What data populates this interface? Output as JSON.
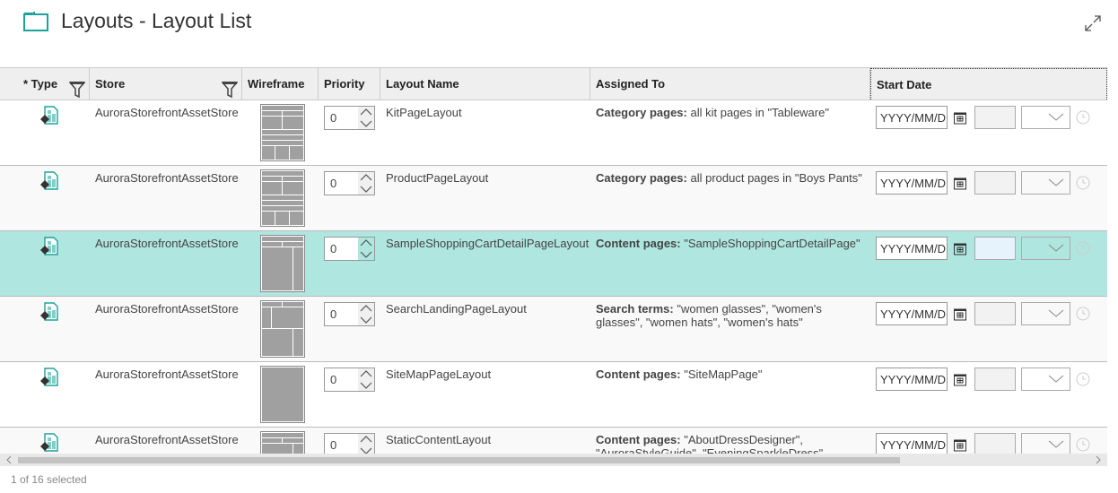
{
  "header": {
    "title": "Layouts - Layout List",
    "icon": "folder-icon",
    "accent": "#1aa39a"
  },
  "columns": [
    "* Type",
    "Store",
    "Wireframe",
    "Priority",
    "Layout Name",
    "Assigned To",
    "Start Date"
  ],
  "rows": [
    {
      "store": "AuroraStorefrontAssetStore",
      "wireframe": "a",
      "priority": "0",
      "name": "KitPageLayout",
      "assign_label": "Category pages:",
      "assign_value": " all kit pages in \"Tableware\"",
      "date_placeholder": "YYYY/MM/DD",
      "selected": false
    },
    {
      "store": "AuroraStorefrontAssetStore",
      "wireframe": "a",
      "priority": "0",
      "name": "ProductPageLayout",
      "assign_label": "Category pages:",
      "assign_value": " all product pages in \"Boys Pants\"",
      "date_placeholder": "YYYY/MM/DD",
      "selected": false
    },
    {
      "store": "AuroraStorefrontAssetStore",
      "wireframe": "b",
      "priority": "0",
      "name": "SampleShoppingCartDetailPageLayout",
      "assign_label": "Content pages:",
      "assign_value": " \"SampleShoppingCartDetailPage\"",
      "date_placeholder": "YYYY/MM/DD",
      "selected": true
    },
    {
      "store": "AuroraStorefrontAssetStore",
      "wireframe": "c",
      "priority": "0",
      "name": "SearchLandingPageLayout",
      "assign_label": "Search terms:",
      "assign_value": " \"women glasses\", \"women's glasses\", \"women hats\", \"women's hats\"",
      "date_placeholder": "YYYY/MM/DD",
      "selected": false
    },
    {
      "store": "AuroraStorefrontAssetStore",
      "wireframe": "d",
      "priority": "0",
      "name": "SiteMapPageLayout",
      "assign_label": "Content pages:",
      "assign_value": " \"SiteMapPage\"",
      "date_placeholder": "YYYY/MM/DD",
      "selected": false
    },
    {
      "store": "AuroraStorefrontAssetStore",
      "wireframe": "b",
      "priority": "0",
      "name": "StaticContentLayout",
      "assign_label": "Content pages:",
      "assign_value": " \"AboutDressDesigner\", \"AuroraStyleGuide\", \"EveningSparkleDress\"",
      "date_placeholder": "YYYY/MM/DD",
      "selected": false
    }
  ],
  "footer": {
    "status": "1 of 16 selected"
  },
  "colors": {
    "selected_row": "#b0e6e0",
    "header_bg": "#efefef"
  }
}
